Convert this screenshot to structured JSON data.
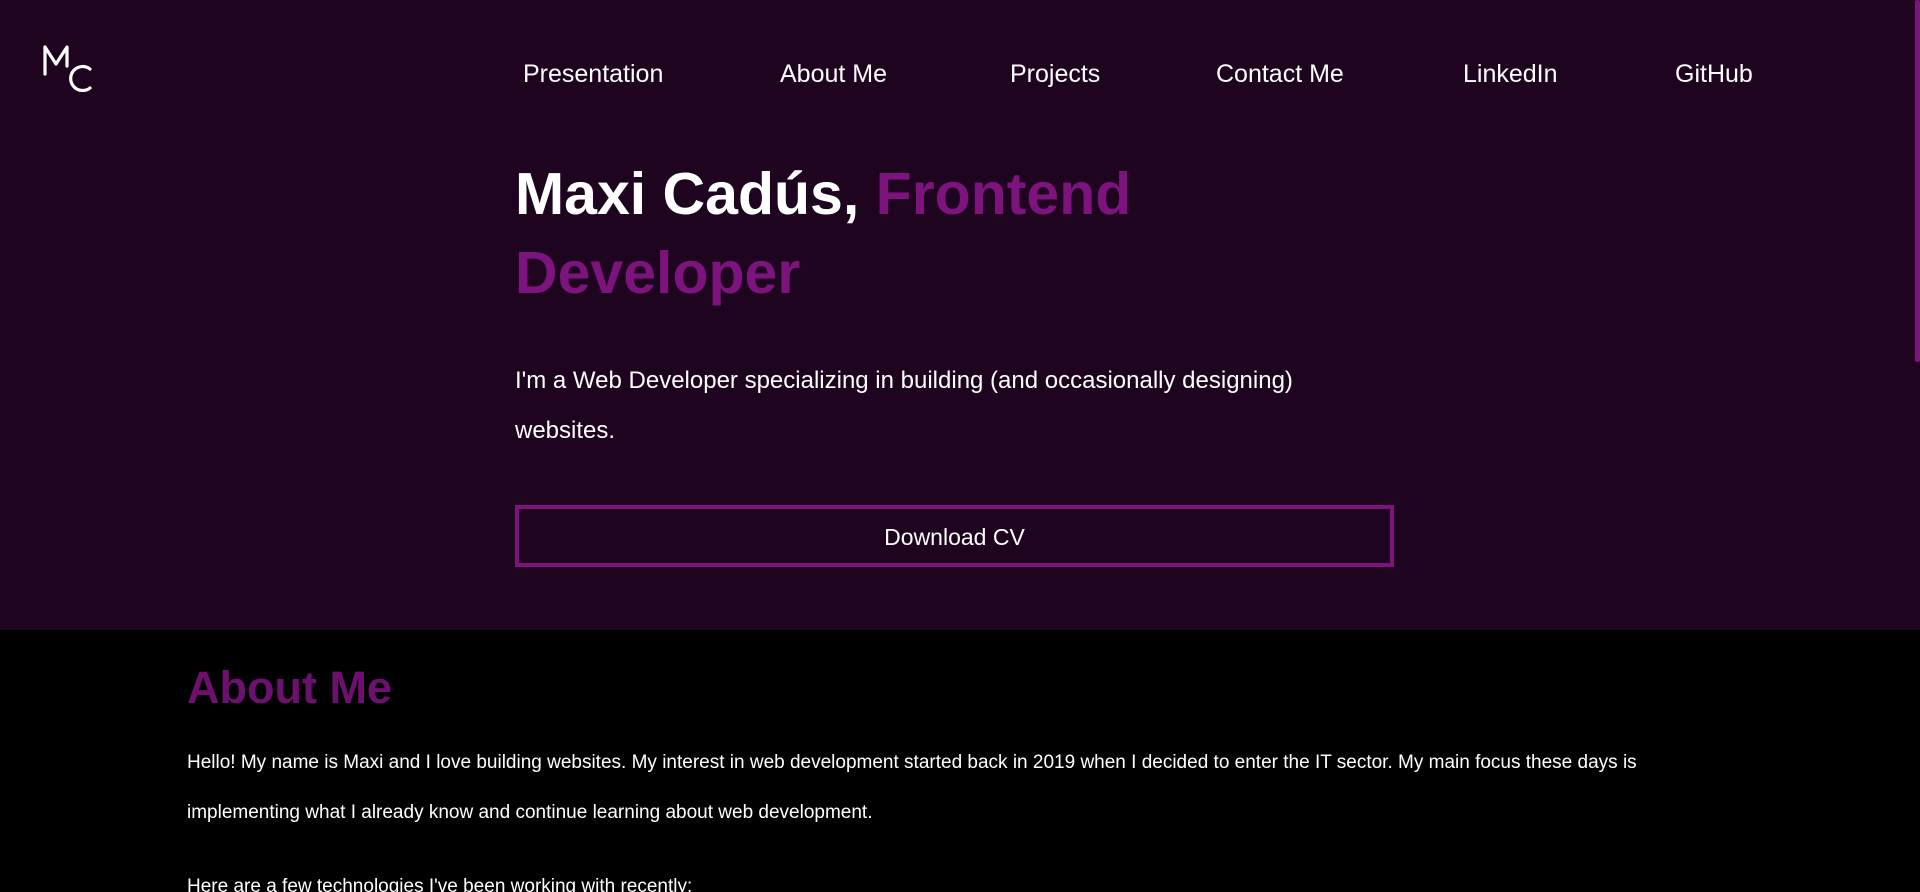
{
  "logo": {
    "text": "MC"
  },
  "nav": {
    "items": [
      {
        "label": "Presentation"
      },
      {
        "label": "About Me"
      },
      {
        "label": "Projects"
      },
      {
        "label": "Contact Me"
      },
      {
        "label": "LinkedIn"
      },
      {
        "label": "GitHub"
      }
    ]
  },
  "hero": {
    "name": "Maxi Cadús, ",
    "role_line1": "Frontend",
    "role_line2": "Developer",
    "description": "I'm a Web Developer specializing in building (and occasionally designing) websites.",
    "cv_button_label": "Download CV"
  },
  "about": {
    "title": "About Me",
    "paragraph1": "Hello! My name is Maxi and I love building websites. My interest in web development started back in 2019 when I decided to enter the IT sector. My main focus these days is implementing what I already know and continue learning about web development.",
    "paragraph2": "Here are a few technologies I've been working with recently:"
  },
  "colors": {
    "hero_background": "#1f0420",
    "accent": "#7d147e",
    "about_title": "#6d106f",
    "about_background": "#000000"
  }
}
